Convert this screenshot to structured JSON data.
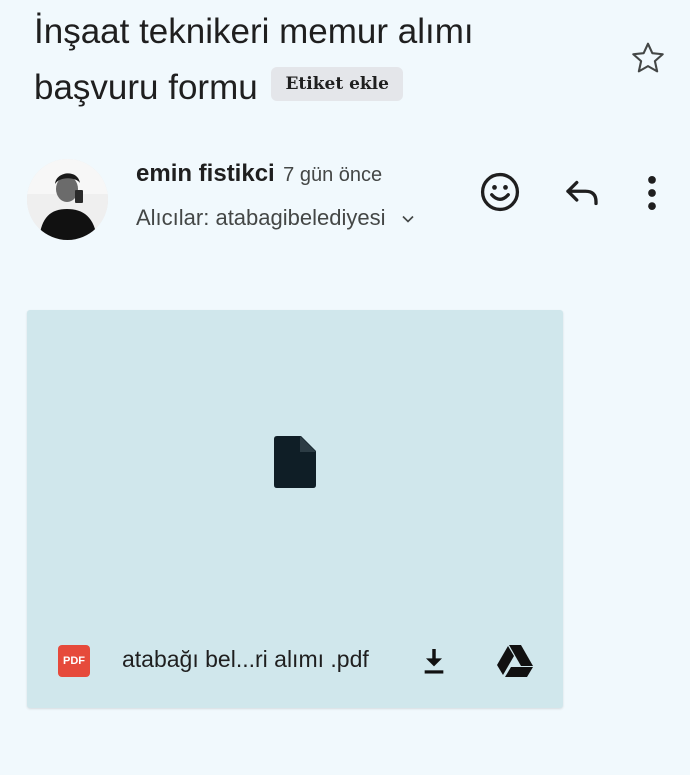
{
  "email": {
    "subject": "İnşaat teknikeri memur alımı başvuru formu",
    "label_button": "Etiket ekle",
    "sender_name": "emin fistikci",
    "time": "7 gün önce",
    "recipients_label": "Alıcılar: atabagibelediyesi"
  },
  "attachment": {
    "type_badge": "PDF",
    "file_name": "atabağı bel...ri alımı .pdf"
  },
  "icons": {
    "star": "star-outline-icon",
    "emoji": "emoji-react-icon",
    "reply": "reply-icon",
    "more": "more-vert-icon",
    "expand": "chevron-down-icon",
    "file": "file-icon",
    "download": "download-icon",
    "drive": "google-drive-icon"
  },
  "colors": {
    "background": "#f1f9fd",
    "attachment_bg": "#d0e7ec",
    "pdf_red": "#e64a3b"
  }
}
